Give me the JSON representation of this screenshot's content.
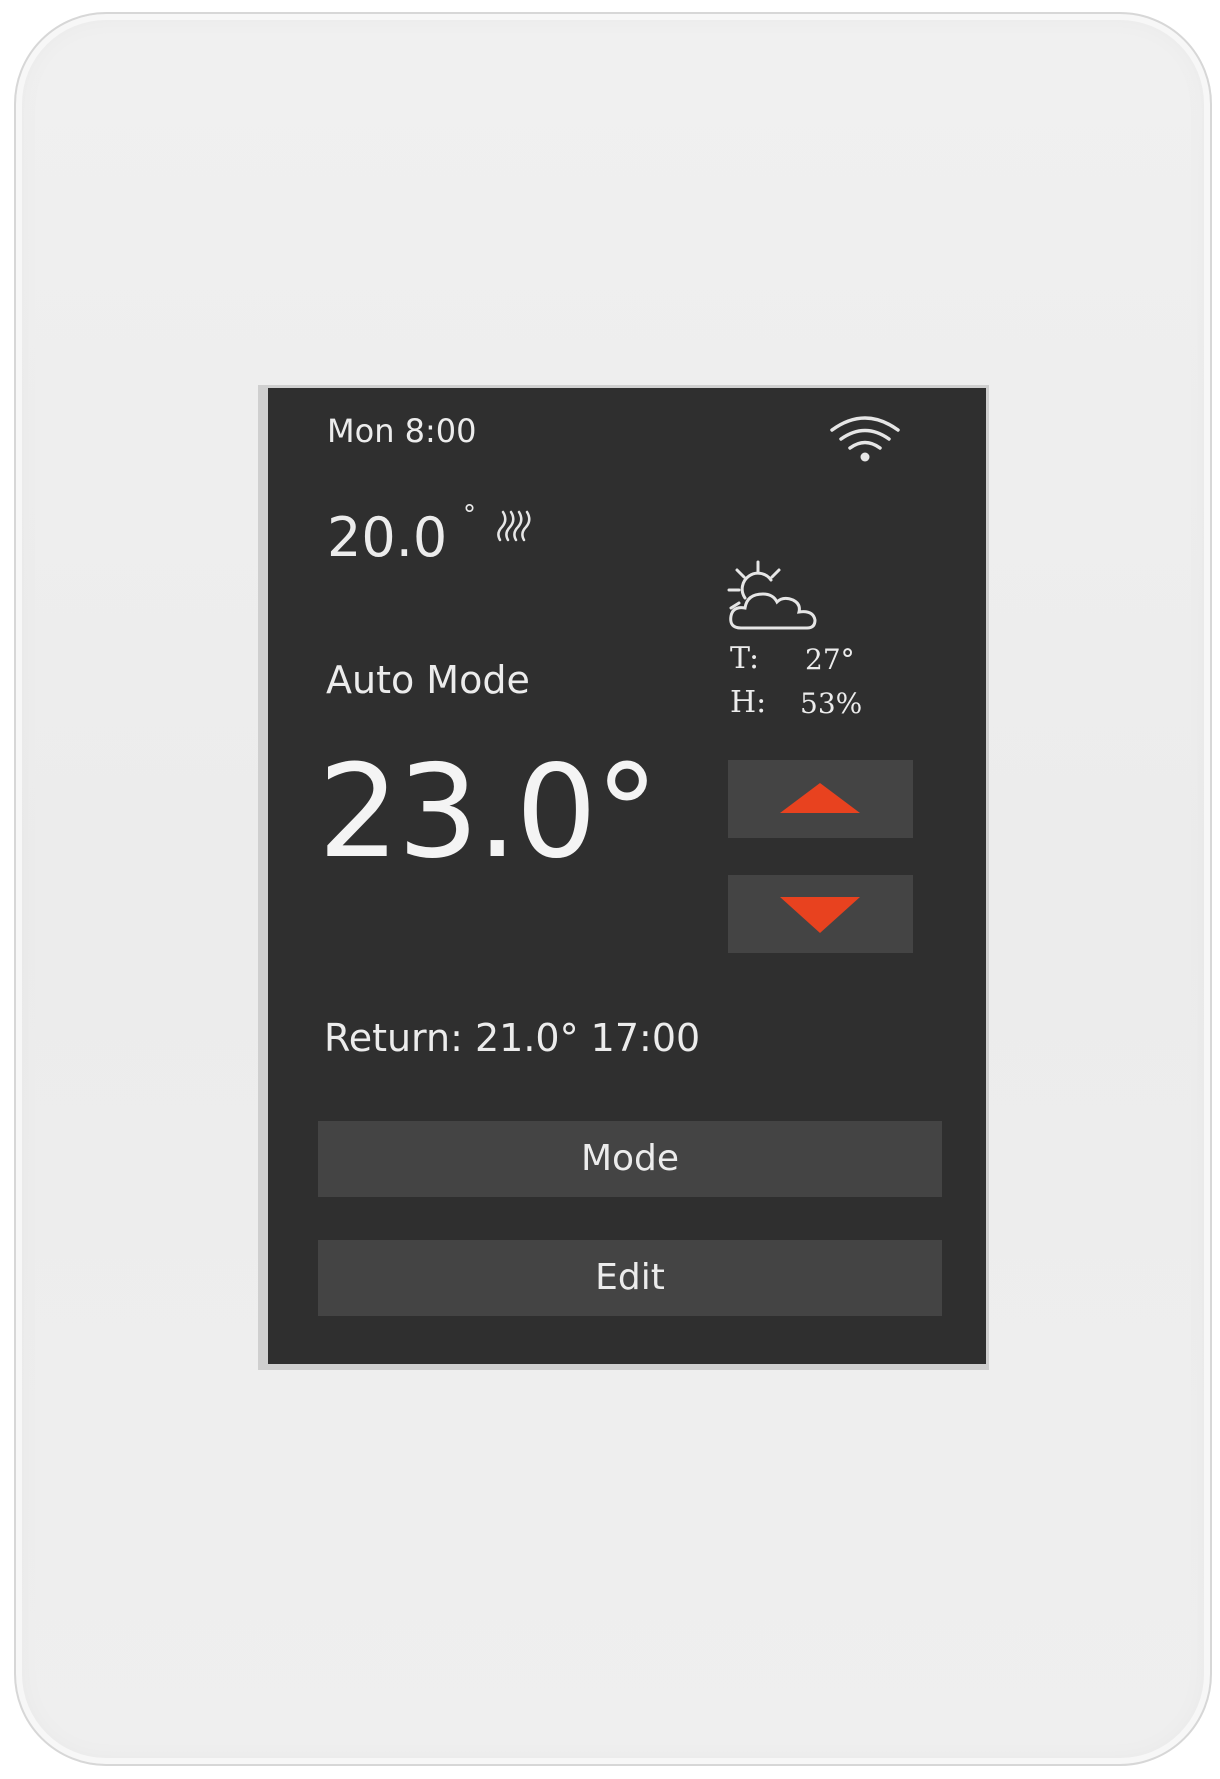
{
  "status": {
    "day": "Mon",
    "time": "8:00",
    "datetime": "Mon  8:00"
  },
  "floor": {
    "temperature": "20.0",
    "degree_symbol": "°"
  },
  "weather": {
    "temp_label": "T:",
    "temp_value": "27°",
    "humidity_label": "H:",
    "humidity_value": "53%"
  },
  "mode": {
    "label": "Auto Mode"
  },
  "setpoint": {
    "value": "23.0°"
  },
  "return": {
    "text": "Return:  21.0°  17:00"
  },
  "buttons": {
    "mode": "Mode",
    "edit": "Edit"
  },
  "icons": {
    "wifi": "wifi-icon",
    "heating": "heating-waves-icon",
    "weather": "partly-cloudy-icon",
    "up": "triangle-up-icon",
    "down": "triangle-down-icon"
  },
  "colors": {
    "screen_bg": "#2f2f2f",
    "button_bg": "#444444",
    "accent": "#e8421f",
    "text": "#ececec"
  }
}
